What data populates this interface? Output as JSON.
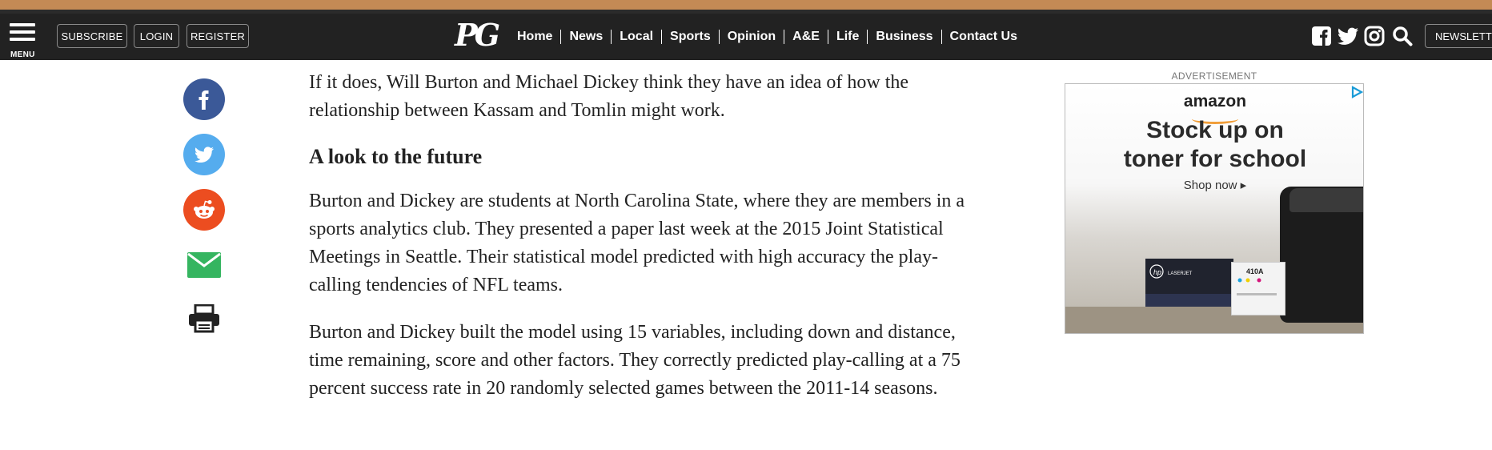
{
  "nav": {
    "menu_label": "MENU",
    "subscribe": "SUBSCRIBE",
    "login": "LOGIN",
    "register": "REGISTER",
    "logo_text": "PG",
    "links": [
      "Home",
      "News",
      "Local",
      "Sports",
      "Opinion",
      "A&E",
      "Life",
      "Business",
      "Contact Us"
    ],
    "social_icons": [
      "facebook-icon",
      "twitter-icon",
      "instagram-icon",
      "search-icon"
    ],
    "newsletter": "NEWSLETTER"
  },
  "share": {
    "icons": [
      "facebook-icon",
      "twitter-icon",
      "reddit-icon",
      "email-icon",
      "print-icon"
    ],
    "colors": {
      "facebook": "#3b5998",
      "twitter": "#55acee",
      "reddit": "#ec4d20",
      "email": "#35b560",
      "print": "#222222"
    }
  },
  "article": {
    "p1": "If it does, Will Burton and Michael Dickey think they have an idea of how the relationship between Kassam and Tomlin might work.",
    "heading": "A look to the future",
    "p2": "Burton and Dickey are students at North Carolina State, where they are members in a sports analytics club. They presented a paper last week at the 2015 Joint Statistical Meetings in Seattle. Their statistical model predicted with high accuracy the play-calling tendencies of NFL teams.",
    "p3": "Burton and Dickey built the model using 15 variables, including down and distance, time remaining, score and other factors. They correctly predicted play-calling at a 75 percent success rate in 20 randomly selected games between the 2011-14 seasons."
  },
  "ad": {
    "label": "ADVERTISEMENT",
    "brand": "amazon",
    "headline_line1": "Stock up on",
    "headline_line2": "toner for school",
    "cta": "Shop now ▸",
    "product_code": "410A",
    "product_name": "LASERJET"
  }
}
